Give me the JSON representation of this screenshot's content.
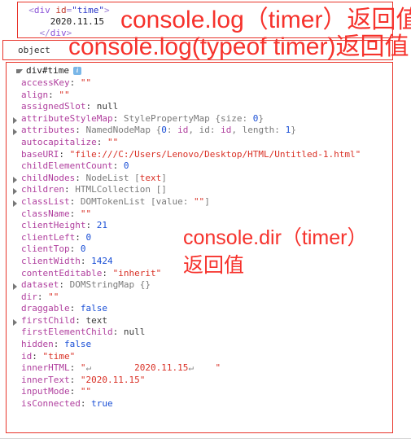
{
  "panels": {
    "html_snippet": {
      "lines": [
        {
          "indent": 2,
          "parts": [
            {
              "t": "<",
              "c": "tag-punct"
            },
            {
              "t": "div",
              "c": "tag-name"
            },
            {
              "t": " ",
              "c": "tag-punct"
            },
            {
              "t": "id",
              "c": "attr-name"
            },
            {
              "t": "=",
              "c": "tag-punct"
            },
            {
              "t": "\"time\"",
              "c": "attr-val"
            },
            {
              "t": ">",
              "c": "tag-punct"
            }
          ]
        },
        {
          "indent": 6,
          "parts": [
            {
              "t": "2020.11.15",
              "c": "text-node"
            }
          ]
        },
        {
          "indent": 4,
          "parts": [
            {
              "t": "</",
              "c": "tag-punct"
            },
            {
              "t": "div",
              "c": "tag-name"
            },
            {
              "t": ">",
              "c": "tag-punct"
            }
          ]
        }
      ]
    },
    "typeof_result": {
      "value": "object"
    },
    "dir_object": {
      "header": "div#time",
      "info_badge": "i",
      "properties": [
        {
          "arrow": false,
          "key": "accessKey",
          "value": "\"\"",
          "vclass": "v-str"
        },
        {
          "arrow": false,
          "key": "align",
          "value": "\"\"",
          "vclass": "v-str"
        },
        {
          "arrow": false,
          "key": "assignedSlot",
          "value": "null",
          "vclass": "v-null"
        },
        {
          "arrow": true,
          "key": "attributeStyleMap",
          "value": "StylePropertyMap {size: 0}",
          "vclass": "v-obj",
          "rich": "attrstylemap"
        },
        {
          "arrow": true,
          "key": "attributes",
          "value": "NamedNodeMap {0: id, id: id, length: 1}",
          "vclass": "v-obj",
          "rich": "attributes"
        },
        {
          "arrow": false,
          "key": "autocapitalize",
          "value": "\"\"",
          "vclass": "v-str"
        },
        {
          "arrow": false,
          "key": "baseURI",
          "value": "\"file:///C:/Users/Lenovo/Desktop/HTML/Untitled-1.html\"",
          "vclass": "v-str"
        },
        {
          "arrow": false,
          "key": "childElementCount",
          "value": "0",
          "vclass": "v-num"
        },
        {
          "arrow": true,
          "key": "childNodes",
          "value": "NodeList [text]",
          "vclass": "v-obj",
          "rich": "childnodes"
        },
        {
          "arrow": true,
          "key": "children",
          "value": "HTMLCollection []",
          "vclass": "v-obj"
        },
        {
          "arrow": true,
          "key": "classList",
          "value": "DOMTokenList [value: \"\"]",
          "vclass": "v-obj",
          "rich": "classlist"
        },
        {
          "arrow": false,
          "key": "className",
          "value": "\"\"",
          "vclass": "v-str"
        },
        {
          "arrow": false,
          "key": "clientHeight",
          "value": "21",
          "vclass": "v-num"
        },
        {
          "arrow": false,
          "key": "clientLeft",
          "value": "0",
          "vclass": "v-num"
        },
        {
          "arrow": false,
          "key": "clientTop",
          "value": "0",
          "vclass": "v-num"
        },
        {
          "arrow": false,
          "key": "clientWidth",
          "value": "1424",
          "vclass": "v-num"
        },
        {
          "arrow": false,
          "key": "contentEditable",
          "value": "\"inherit\"",
          "vclass": "v-str"
        },
        {
          "arrow": true,
          "key": "dataset",
          "value": "DOMStringMap {}",
          "vclass": "v-obj"
        },
        {
          "arrow": false,
          "key": "dir",
          "value": "\"\"",
          "vclass": "v-str"
        },
        {
          "arrow": false,
          "key": "draggable",
          "value": "false",
          "vclass": "v-bool"
        },
        {
          "arrow": true,
          "key": "firstChild",
          "value": "text",
          "vclass": "v-plain"
        },
        {
          "arrow": false,
          "key": "firstElementChild",
          "value": "null",
          "vclass": "v-null"
        },
        {
          "arrow": false,
          "key": "hidden",
          "value": "false",
          "vclass": "v-bool"
        },
        {
          "arrow": false,
          "key": "id",
          "value": "\"time\"",
          "vclass": "v-str"
        },
        {
          "arrow": false,
          "key": "innerHTML",
          "value": "\"↵        2020.11.15↵    \"",
          "vclass": "v-str",
          "rich": "innerhtml"
        },
        {
          "arrow": false,
          "key": "innerText",
          "value": "\"2020.11.15\"",
          "vclass": "v-str"
        },
        {
          "arrow": false,
          "key": "inputMode",
          "value": "\"\"",
          "vclass": "v-str"
        },
        {
          "arrow": false,
          "key": "isConnected",
          "value": "true",
          "vclass": "v-bool"
        }
      ]
    }
  },
  "annotations": {
    "log_return": "console.log（timer）返回值",
    "typeof_return": "console.log(typeof timer)返回值",
    "dir_return": "console.dir（timer）\n返回值"
  },
  "colors": {
    "annotation_red": "#f6322c",
    "border_red": "#e8342a",
    "key_purple": "#b03f9e",
    "string_red": "#d93025",
    "number_blue": "#1a4fd6"
  }
}
